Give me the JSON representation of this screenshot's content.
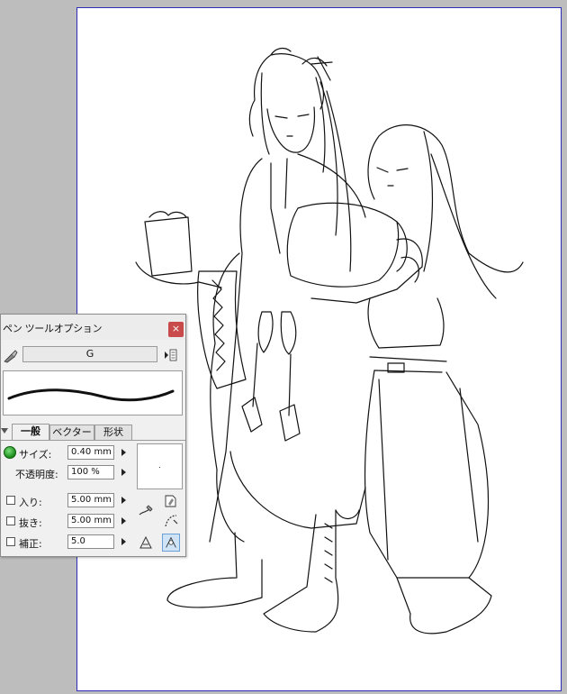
{
  "panel": {
    "title": "ペン ツールオプション",
    "close_label": "×",
    "brush_name": "G",
    "tabs": [
      "一般",
      "ベクター",
      "形状"
    ],
    "active_tab": "一般",
    "settings": [
      {
        "label": "サイズ:",
        "value": "0.40 mm",
        "enabled": true,
        "indicator": "green-dot"
      },
      {
        "label": "不透明度:",
        "value": "100 %"
      },
      {
        "label": "入り:",
        "value": "5.00 mm",
        "checked": false
      },
      {
        "label": "抜き:",
        "value": "5.00 mm",
        "checked": false
      },
      {
        "label": "補正:",
        "value": "5.0",
        "checked": false
      }
    ]
  },
  "colors": {
    "paper_border": "#2e2eb8",
    "close_button": "#c84a4a",
    "canvas_bg": "#bdbdbd",
    "size_indicator": "#1a8a1a"
  }
}
